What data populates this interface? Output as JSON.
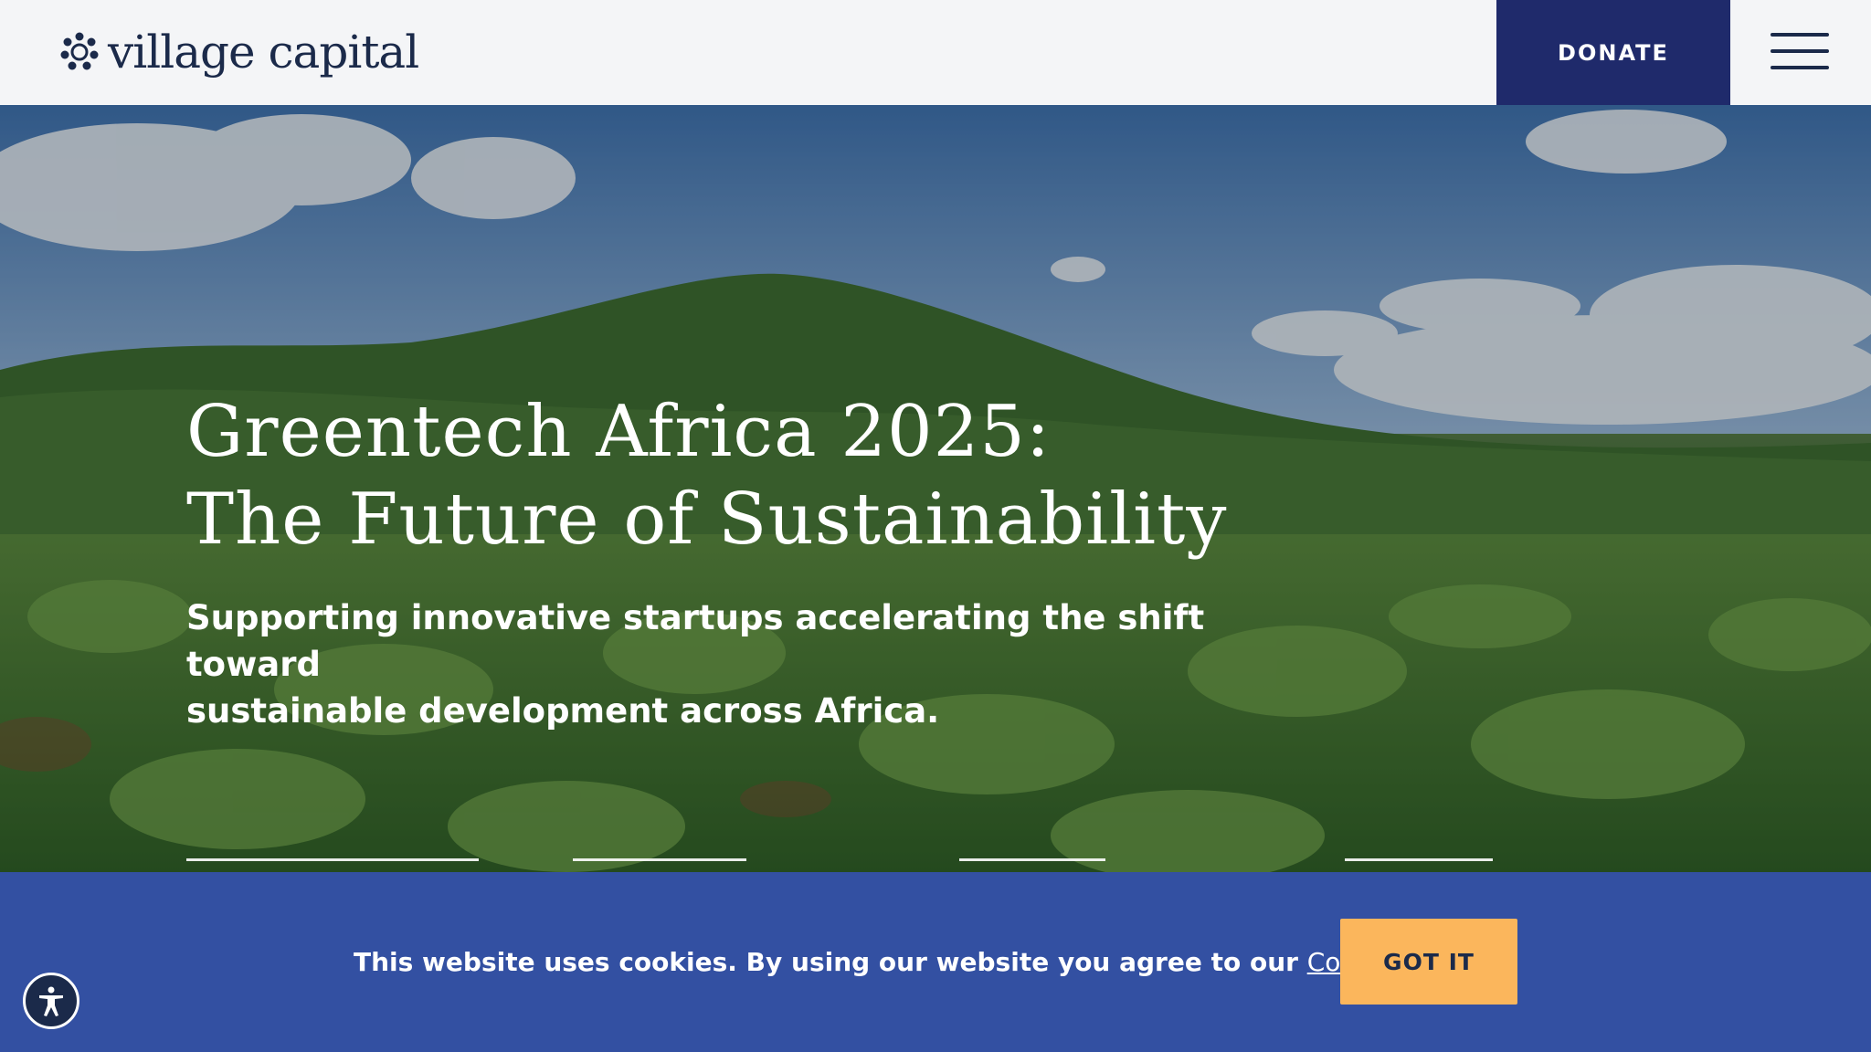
{
  "header": {
    "logo_text": "village capital",
    "donate_label": "DONATE",
    "menu_icon": "hamburger-menu-icon"
  },
  "hero": {
    "title_line1": "Greentech Africa 2025:",
    "title_line2": "The Future of Sustainability",
    "subtitle_line1": "Supporting innovative startups accelerating the shift toward",
    "subtitle_line2": "sustainable development across Africa.",
    "background": "landscape-photo: green crop field with hill and blue sky"
  },
  "cookie_banner": {
    "text": "This website uses cookies. By using our website you agree to our",
    "link_label": "Cookie Policy",
    "accept_label": "GOT IT"
  },
  "accessibility_icon": "accessibility-icon",
  "colors": {
    "navy": "#1f2a6b",
    "banner_blue": "#3350a2",
    "accept_orange": "#fbb65c",
    "header_bg": "#f4f5f7"
  }
}
